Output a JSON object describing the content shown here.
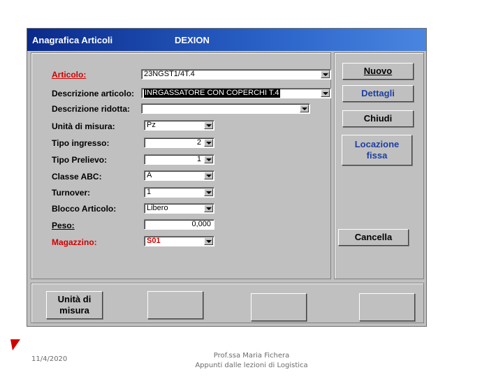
{
  "window": {
    "title": "Anagrafica Articoli",
    "subtitle": "DEXION"
  },
  "form": {
    "articolo": {
      "label": "Articolo:",
      "value": "23NGST1/4T.4"
    },
    "descrizione": {
      "label": "Descrizione articolo:",
      "value": "INRGASSATORE CON COPERCHI T.4"
    },
    "descrizione_ridotta": {
      "label": "Descrizione ridotta:",
      "value": ""
    },
    "unita_misura": {
      "label": "Unità di misura:",
      "value": "Pz"
    },
    "tipo_ingresso": {
      "label": "Tipo ingresso:",
      "value": "2"
    },
    "tipo_prelievo": {
      "label": "Tipo Prelievo:",
      "value": "1"
    },
    "classe_abc": {
      "label": "Classe ABC:",
      "value": "A"
    },
    "turnover": {
      "label": "Turnover:",
      "value": "1"
    },
    "blocco_articolo": {
      "label": "Blocco Articolo:",
      "value": "Libero"
    },
    "peso": {
      "label": "Peso:",
      "value": "0,000"
    },
    "magazzino": {
      "label": "Magazzino:",
      "value": "S01"
    }
  },
  "buttons": {
    "nuovo": "Nuovo",
    "dettagli": "Dettagli",
    "chiudi": "Chiudi",
    "locazione_line1": "Locazione",
    "locazione_line2": "fissa",
    "cancella": "Cancella",
    "unita_line1": "Unità di",
    "unita_line2": "misura"
  },
  "footer": {
    "date": "11/4/2020",
    "author": "Prof.ssa Maria Fichera",
    "course": "Appunti dalle lezioni di Logistica"
  },
  "colors": {
    "title_bar": "#0a2a8a",
    "required_label": "#d10000",
    "window_bg": "#c0c0c0",
    "accent_marker": "#d10000"
  }
}
